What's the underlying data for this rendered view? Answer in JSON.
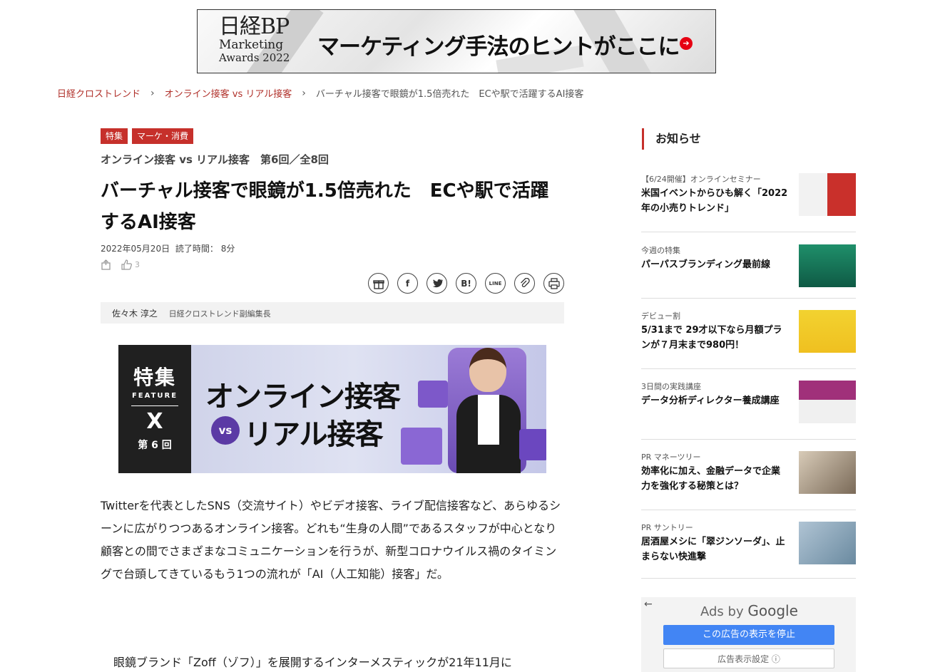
{
  "banner": {
    "brand_line1": "日経BP",
    "brand_line2": "Marketing",
    "brand_line3": "Awards 2022",
    "slogan": "マーケティング手法のヒントがここに"
  },
  "breadcrumb": {
    "items": [
      "日経クロストレンド",
      "オンライン接客 vs リアル接客"
    ],
    "current": "バーチャル接客で眼鏡が1.5倍売れた　ECや駅で活躍するAI接客"
  },
  "article": {
    "tags": [
      "特集",
      "マーケ・消費"
    ],
    "series": "オンライン接客 vs リアル接客　第6回／全8回",
    "title": "バーチャル接客で眼鏡が1.5倍売れた　ECや駅で活躍するAI接客",
    "date": "2022年05月20日",
    "read_time": "読了時間： 8分",
    "like_count": "3",
    "author_name": "佐々木 淳之",
    "author_role": "日経クロストレンド副編集長",
    "feature_image": {
      "label_top": "特集",
      "label_feature": "FEATURE",
      "label_x": "X",
      "episode": "第 6 回",
      "headline1": "オンライン接客",
      "vs": "vs",
      "headline2": "リアル接客"
    },
    "paragraph1": "Twitterを代表としたSNS（交流サイト）やビデオ接客、ライブ配信接客など、あらゆるシーンに広がりつつあるオンライン接客。どれも“生身の人間”であるスタッフが中心となり顧客との間でさまざまなコミュニケーションを行うが、新型コロナウイルス禍のタイミングで台頭してきているもう1つの流れが「AI（人工知能）接客」だ。",
    "paragraph2": "眼鏡ブランド「Zoff（ゾフ）」を展開するインターメスティックが21年11月に"
  },
  "share": {
    "icons": [
      "gift-icon",
      "facebook-icon",
      "twitter-icon",
      "hatena-bookmark-icon",
      "line-icon",
      "link-icon",
      "print-icon"
    ],
    "labels": [
      "🎁",
      "f",
      "🐦",
      "B!",
      "LINE",
      "🔗",
      "🖶"
    ]
  },
  "sidebar": {
    "heading": "お知らせ",
    "items": [
      {
        "category": "【6/24開催】オンラインセミナー",
        "title": "米国イベントからひも解く「2022年の小売りトレンド」",
        "thumb_color": "#c9302b"
      },
      {
        "category": "今週の特集",
        "title": "パーパスブランディング最前線",
        "thumb_color": "#1a7a5c"
      },
      {
        "category": "デビュー割",
        "title": "5/31まで 29才以下なら月額プランが７月末まで980円！",
        "thumb_color": "#f2d230"
      },
      {
        "category": "3日間の実践講座",
        "title": "データ分析ディレクター養成講座",
        "thumb_color": "#8c2f7a"
      },
      {
        "category": "PR マネーツリー",
        "title": "効率化に加え、金融データで企業力を強化する秘策とは？",
        "thumb_color": "#8a7a6a"
      },
      {
        "category": "PR サントリー",
        "title": "居酒屋メシに「翠ジンソーダ」、止まらない快進撃",
        "thumb_color": "#7a9ab0"
      }
    ]
  },
  "ads": {
    "back": "←",
    "ads_by": "Ads by",
    "google": "Google",
    "stop_label": "この広告の表示を停止",
    "settings_label": "広告表示設定 ⓘ"
  }
}
